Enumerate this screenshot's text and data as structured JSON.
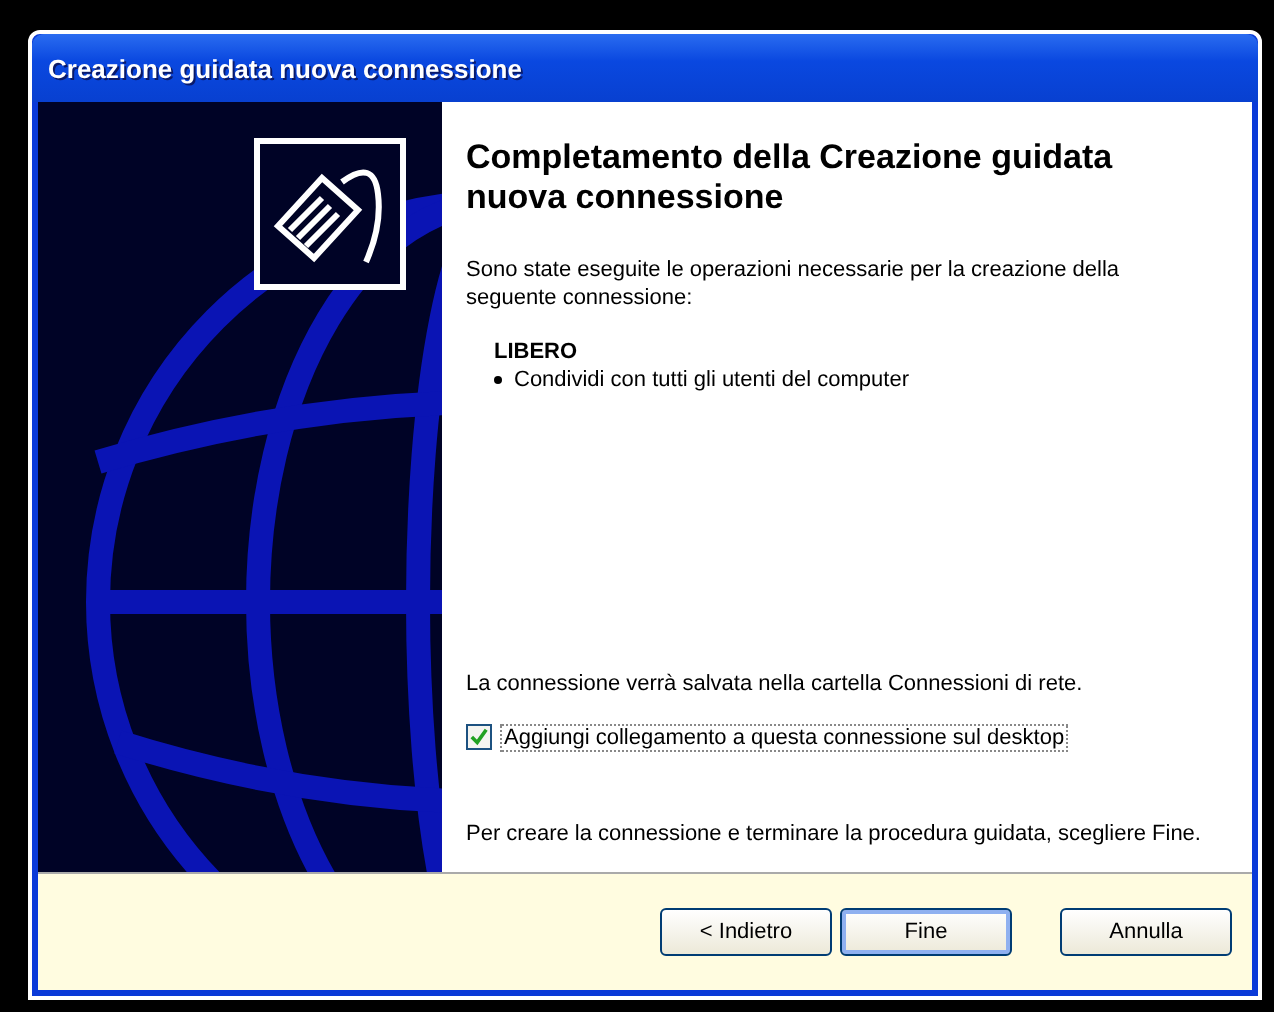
{
  "window": {
    "title": "Creazione guidata nuova connessione"
  },
  "heading": "Completamento della Creazione guidata nuova connessione",
  "intro": "Sono state eseguite le operazioni necessarie per la creazione della seguente connessione:",
  "connection": {
    "name": "LIBERO",
    "details": [
      "Condividi con tutti gli utenti del computer"
    ]
  },
  "save_note": "La connessione verrà salvata nella cartella Connessioni di rete.",
  "shortcut_checkbox": {
    "label": "Aggiungi collegamento a questa connessione sul desktop",
    "checked": true
  },
  "finish_note": "Per creare la connessione e terminare la procedura guidata, scegliere Fine.",
  "buttons": [
    {
      "label": "< Indietro",
      "default": false
    },
    {
      "label": "Fine",
      "default": true
    },
    {
      "label": "Annulla",
      "default": false
    }
  ]
}
